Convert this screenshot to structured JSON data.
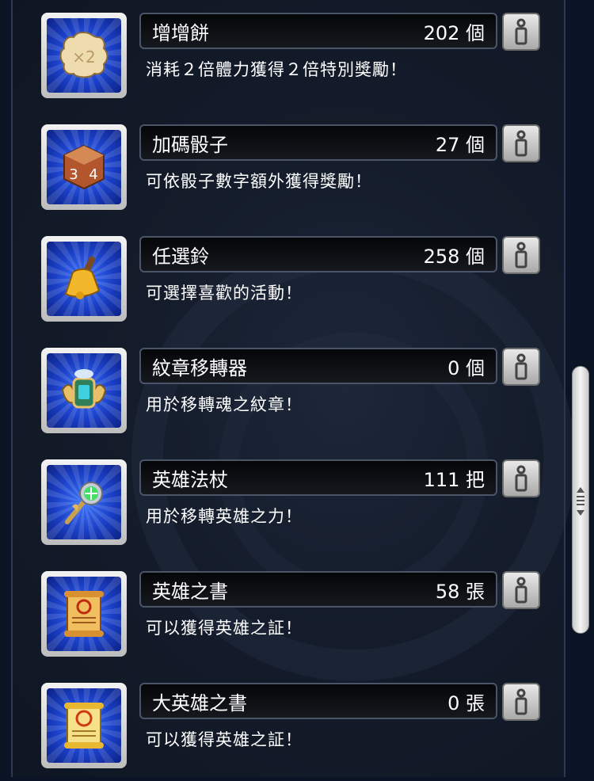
{
  "items": [
    {
      "name": "增增餅",
      "count": "202 個",
      "desc": "消耗２倍體力獲得２倍特別獎勵！",
      "icon": "mochi-x2-icon"
    },
    {
      "name": "加碼骰子",
      "count": "27 個",
      "desc": "可依骰子數字額外獲得獎勵！",
      "icon": "dice-icon"
    },
    {
      "name": "任選鈴",
      "count": "258 個",
      "desc": "可選擇喜歡的活動！",
      "icon": "bell-icon"
    },
    {
      "name": "紋章移轉器",
      "count": "0 個",
      "desc": "用於移轉魂之紋章！",
      "icon": "emblem-transfer-icon"
    },
    {
      "name": "英雄法杖",
      "count": "111 把",
      "desc": "用於移轉英雄之力！",
      "icon": "hero-staff-icon"
    },
    {
      "name": "英雄之書",
      "count": "58 張",
      "desc": "可以獲得英雄之証！",
      "icon": "hero-scroll-icon"
    },
    {
      "name": "大英雄之書",
      "count": "0 張",
      "desc": "可以獲得英雄之証！",
      "icon": "great-hero-scroll-icon"
    }
  ],
  "info_icon": "info-icon",
  "colors": {
    "panel": "#141c2b",
    "icon_bg": "#1a3fc6",
    "text": "#ffffff"
  }
}
